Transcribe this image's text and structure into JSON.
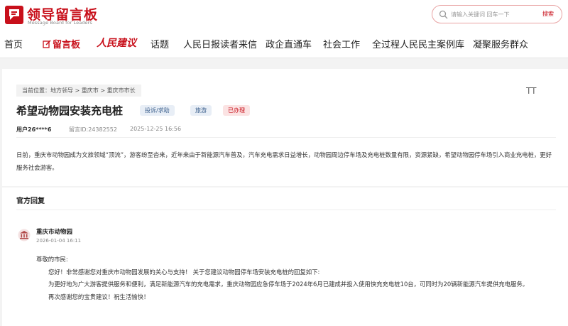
{
  "header": {
    "logo_title": "领导留言板",
    "logo_subtitle": "Message Board for Leaders",
    "search_placeholder": "请输入关键词 回车一下",
    "search_button": "搜索"
  },
  "nav": {
    "items": [
      "首页",
      "留言板",
      "人民建议",
      "话题",
      "人民日报读者来信",
      "政企直通车",
      "社会工作",
      "全过程人民民主案例库",
      "凝聚服务群众"
    ]
  },
  "message": {
    "breadcrumb_prefix": "当前位置：",
    "breadcrumb": [
      "地方领导",
      "重庆市",
      "重庆市市长"
    ],
    "font_toggle": "TT",
    "title": "希望动物园安装充电桩",
    "tags": [
      "投诉/求助",
      "旅游",
      "已办理"
    ],
    "user": "用户26****6",
    "message_id": "留言ID:24382552",
    "date": "2025-12-25 16:56",
    "content": "日前，重庆市动物园成为文旅领域“顶流”，游客纷至沓来，近年来由于新能源汽车普及，汽车充电需求日益增长，动物园周边停车场及充电桩数量有限，资源紧缺，希望动物园停车场引入商业充电桩，更好服务社会游客。"
  },
  "reply": {
    "heading": "官方回复",
    "org": "重庆市动物园",
    "date": "2026-01-04 16:11",
    "greeting": "尊敬的市民:",
    "para1": "您好！非常感谢您对重庆市动物园发展的关心与支持！ 关于您建议动物园停车场安装充电桩的回复如下:",
    "para2": "为更好地为广大游客提供服务和便利，满足新能源汽车的充电需求，重庆动物园应急停车场于2024年6月已建成并投入使用快充充电桩10台，可同时为20辆新能源汽车提供充电服务。",
    "para3": "再次感谢您的宝贵建议！祝生活愉快！"
  },
  "colors": {
    "brand_red": "#c8101b",
    "tag_blue_bg": "#e8eef6",
    "tag_red_bg": "#fbe3e3"
  }
}
